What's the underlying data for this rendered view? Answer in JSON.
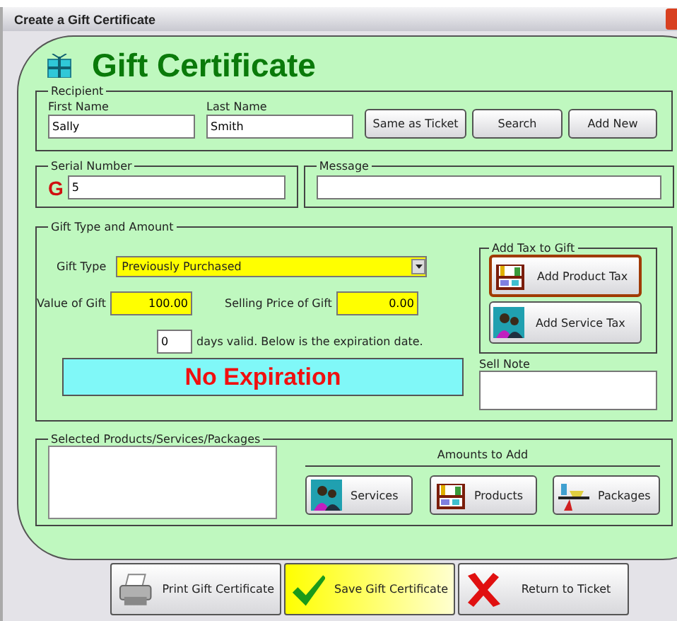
{
  "window": {
    "title": "Create a Gift Certificate"
  },
  "header": {
    "title": "Gift Certificate"
  },
  "recipient": {
    "legend": "Recipient",
    "first_name": {
      "label": "First Name",
      "value": "Sally"
    },
    "last_name": {
      "label": "Last Name",
      "value": "Smith"
    },
    "buttons": [
      {
        "label": "Same as Ticket"
      },
      {
        "label": "Search"
      },
      {
        "label": "Add New"
      }
    ]
  },
  "serial": {
    "legend": "Serial Number",
    "prefix": "G",
    "value": "5"
  },
  "message": {
    "legend": "Message"
  },
  "gift_type_and_amount": {
    "legend": "Gift Type and Amount",
    "gift_type": {
      "label": "Gift Type",
      "value": "Previously Purchased"
    },
    "value_of_gift": {
      "label": "Value of Gift",
      "value": "100.00"
    },
    "selling_price": {
      "label": "Selling Price of Gift",
      "value": "0.00"
    },
    "days_valid": {
      "value": "0",
      "text": "days valid. Below is the expiration date."
    },
    "expiration": "No Expiration",
    "add_tax": {
      "legend": "Add Tax to Gift",
      "buttons": [
        {
          "label": "Add Product Tax",
          "kind": "product",
          "focused": true
        },
        {
          "label": "Add Service Tax",
          "kind": "service",
          "focused": false
        }
      ]
    },
    "sell_note": {
      "label": "Sell Note"
    }
  },
  "selected_items": {
    "legend": "Selected Products/Services/Packages",
    "amounts_label": "Amounts to Add",
    "buttons": [
      {
        "label": "Services",
        "kind": "service"
      },
      {
        "label": "Products",
        "kind": "product"
      },
      {
        "label": "Packages",
        "kind": "package"
      }
    ]
  },
  "footer": {
    "buttons": [
      {
        "label": "Print Gift Certificate",
        "kind": "print",
        "highlighted": false
      },
      {
        "label": "Save Gift Certificate",
        "kind": "save",
        "highlighted": true
      },
      {
        "label": "Return to Ticket",
        "kind": "cancel",
        "highlighted": false
      }
    ]
  }
}
